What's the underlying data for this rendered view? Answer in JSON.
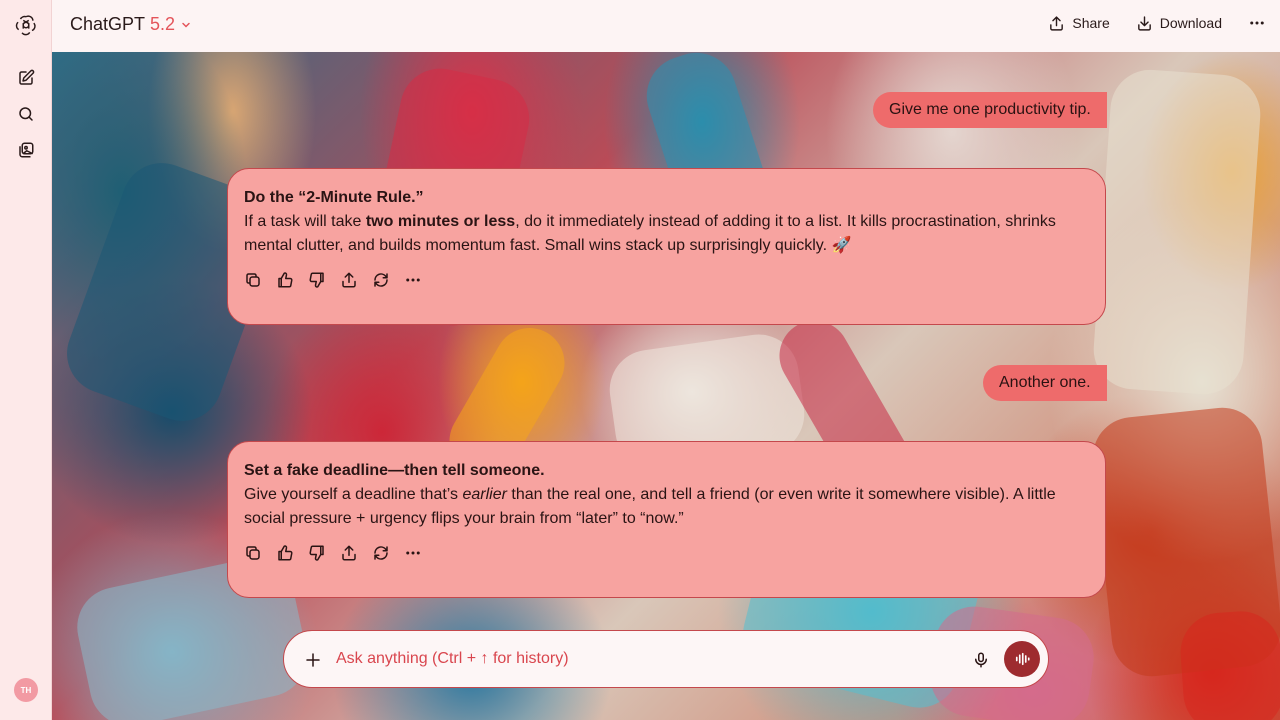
{
  "header": {
    "model_name": "ChatGPT",
    "model_version": "5.2",
    "share_label": "Share",
    "download_label": "Download"
  },
  "sidebar": {
    "avatar_initials": "TH",
    "icons": [
      "openai-logo-icon",
      "new-chat-icon",
      "search-icon",
      "library-icon"
    ]
  },
  "messages": [
    {
      "role": "user",
      "text": "Give me one productivity tip."
    },
    {
      "role": "assistant",
      "title": "Do the “2-Minute Rule.”",
      "body_pre": "If a task will take ",
      "body_bold": "two minutes or less",
      "body_post": ", do it immediately instead of adding it to a list. It kills procrastination, shrinks mental clutter, and builds momentum fast. Small wins stack up surprisingly quickly. 🚀"
    },
    {
      "role": "user",
      "text": "Another one."
    },
    {
      "role": "assistant",
      "title": "Set a fake deadline—then tell someone.",
      "body_pre": "Give yourself a deadline that’s ",
      "body_italic": "earlier",
      "body_post": " than the real one, and tell a friend (or even write it somewhere visible). A little social pressure + urgency flips your brain from “later” to “now.”"
    }
  ],
  "composer": {
    "placeholder": "Ask anything (Ctrl + ↑ for history)"
  },
  "colors": {
    "accent": "#e4545a",
    "user_bubble": "#ee6b6b",
    "assistant_card": "#f7a3a0",
    "voice_button": "#9e2b2f",
    "sidebar_bg": "#fde9e9"
  }
}
